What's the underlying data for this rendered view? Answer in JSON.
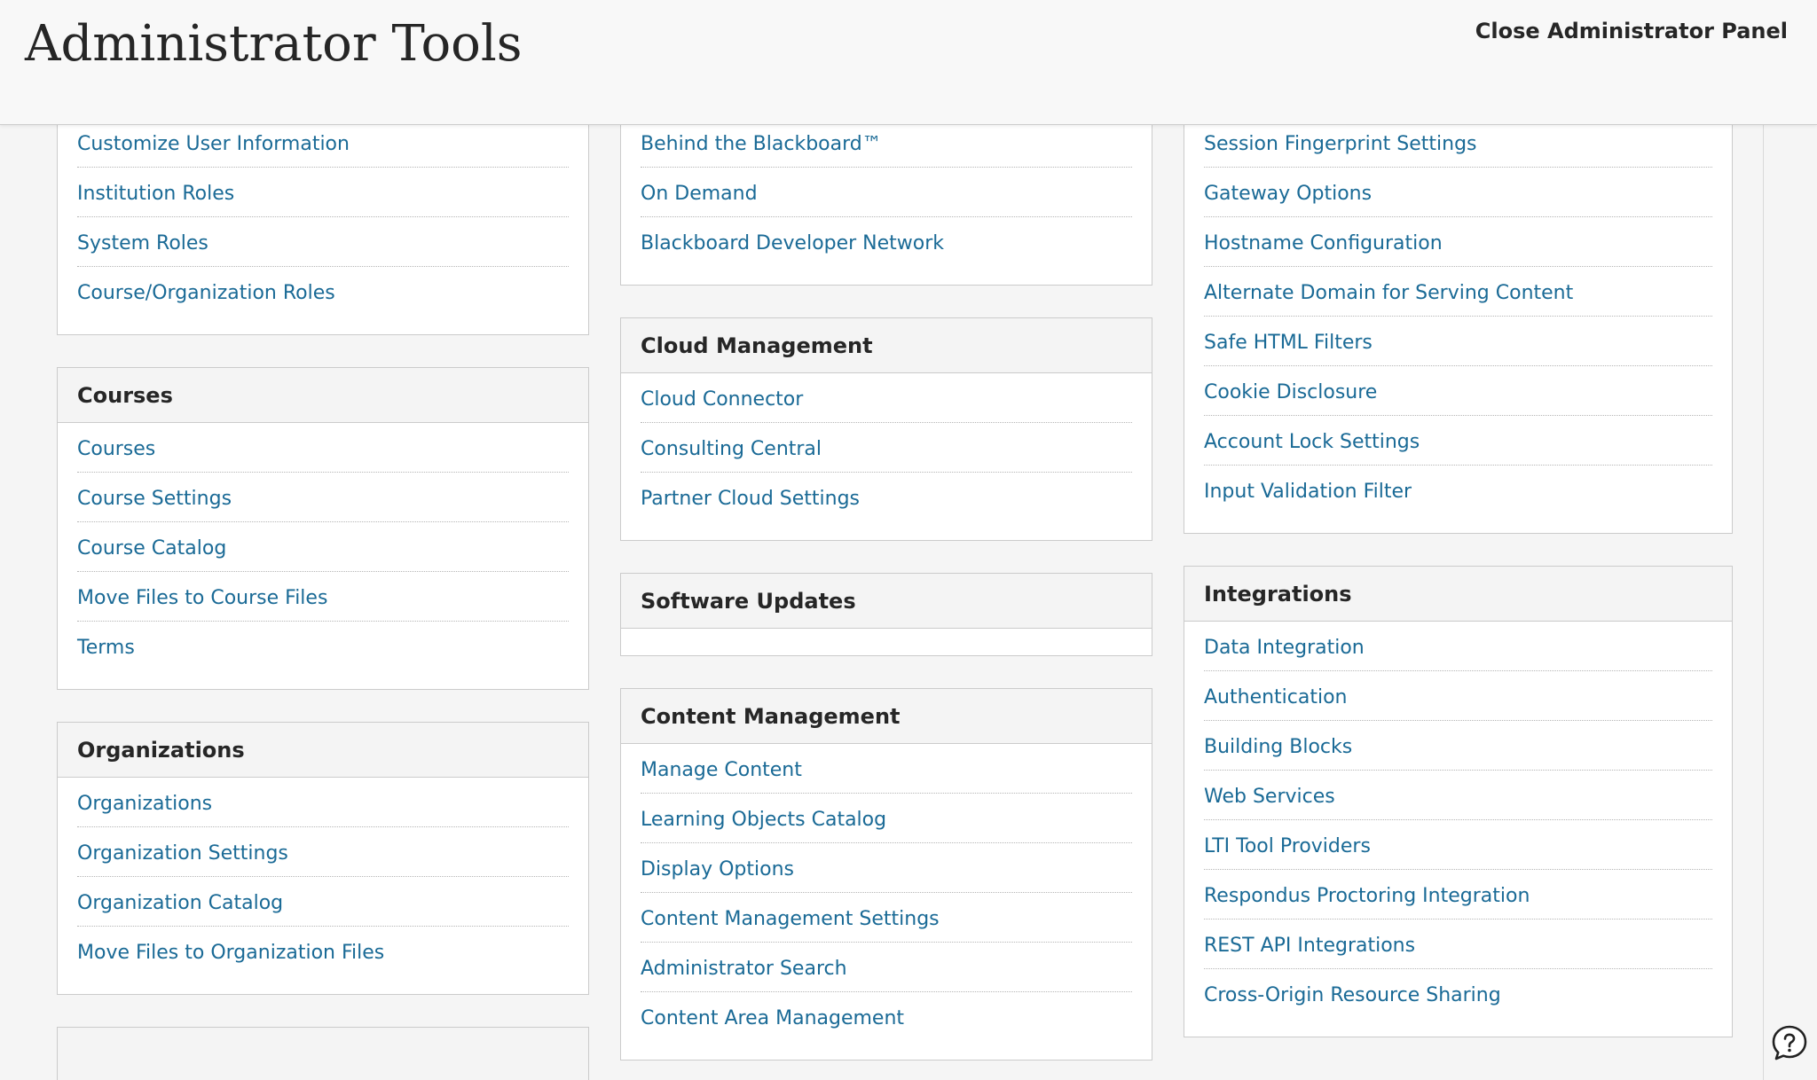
{
  "header": {
    "title": "Administrator Tools",
    "close_label": "Close Administrator Panel"
  },
  "columns": {
    "col1": {
      "users_tail": {
        "items": [
          "Customize User Information",
          "Institution Roles",
          "System Roles",
          "Course/Organization Roles"
        ]
      },
      "courses": {
        "title": "Courses",
        "items": [
          "Courses",
          "Course Settings",
          "Course Catalog",
          "Move Files to Course Files",
          "Terms"
        ]
      },
      "organizations": {
        "title": "Organizations",
        "items": [
          "Organizations",
          "Organization Settings",
          "Organization Catalog",
          "Move Files to Organization Files"
        ]
      }
    },
    "col2": {
      "community_tail": {
        "items": [
          "Behind the Blackboard™",
          "On Demand",
          "Blackboard Developer Network"
        ]
      },
      "cloud": {
        "title": "Cloud Management",
        "items": [
          "Cloud Connector",
          "Consulting Central",
          "Partner Cloud Settings"
        ]
      },
      "software_updates": {
        "title": "Software Updates",
        "items": []
      },
      "content_management": {
        "title": "Content Management",
        "items": [
          "Manage Content",
          "Learning Objects Catalog",
          "Display Options",
          "Content Management Settings",
          "Administrator Search",
          "Content Area Management"
        ]
      }
    },
    "col3": {
      "security_tail": {
        "items": [
          "Session Fingerprint Settings",
          "Gateway Options",
          "Hostname Configuration",
          "Alternate Domain for Serving Content",
          "Safe HTML Filters",
          "Cookie Disclosure",
          "Account Lock Settings",
          "Input Validation Filter"
        ]
      },
      "integrations": {
        "title": "Integrations",
        "items": [
          "Data Integration",
          "Authentication",
          "Building Blocks",
          "Web Services",
          "LTI Tool Providers",
          "Respondus Proctoring Integration",
          "REST API Integrations",
          "Cross-Origin Resource Sharing"
        ]
      }
    }
  },
  "colors": {
    "link": "#1a6a96",
    "heading": "#262626",
    "panel_border": "#cbcbcb",
    "panel_header_bg": "#f4f4f4"
  },
  "icons": {
    "help": "help-icon"
  }
}
